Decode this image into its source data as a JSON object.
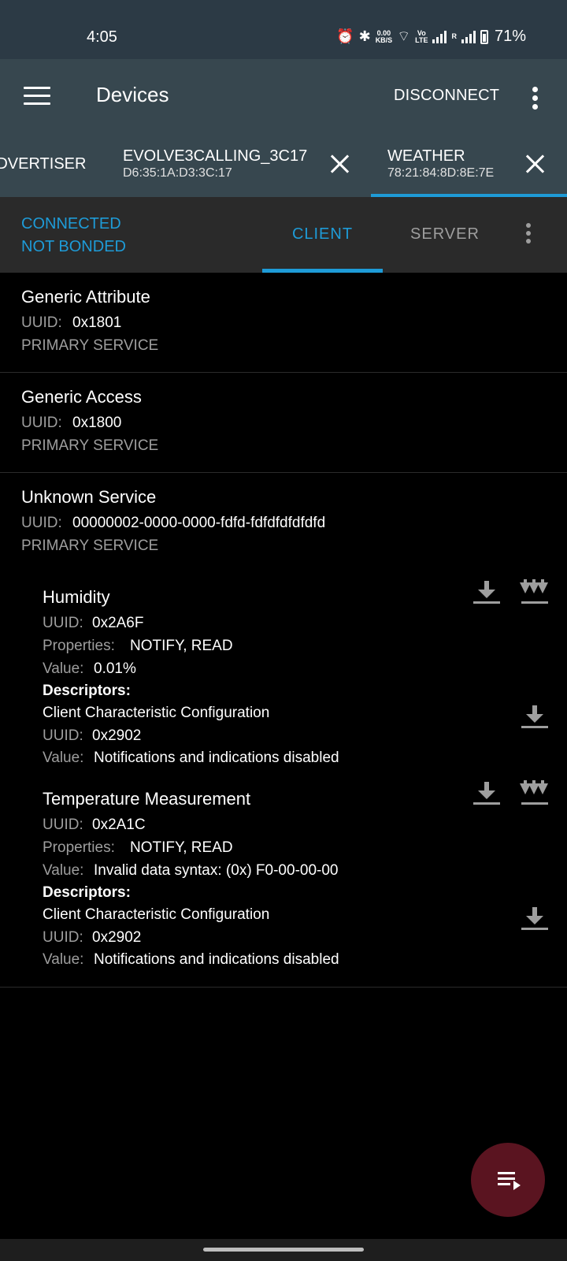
{
  "status_bar": {
    "time": "4:05",
    "net_speed_value": "0.00",
    "net_speed_unit": "KB/S",
    "volte_top": "Vo",
    "volte_bottom": "LTE",
    "roaming": "R",
    "battery": "71%"
  },
  "app_bar": {
    "title": "Devices",
    "disconnect_label": "DISCONNECT"
  },
  "device_tabs": [
    {
      "name": "ADVERTISER",
      "address": ""
    },
    {
      "name": "EVOLVE3CALLING_3C17",
      "address": "D6:35:1A:D3:3C:17"
    },
    {
      "name": "WEATHER",
      "address": "78:21:84:8D:8E:7E",
      "selected": true
    }
  ],
  "connection": {
    "state": "CONNECTED",
    "bond": "NOT BONDED"
  },
  "role_tabs": {
    "client": "CLIENT",
    "server": "SERVER",
    "selected": "CLIENT"
  },
  "labels": {
    "uuid": "UUID:",
    "properties": "Properties:",
    "value": "Value:",
    "descriptors": "Descriptors:"
  },
  "services": [
    {
      "name": "Generic Attribute",
      "uuid": "0x1801",
      "type": "PRIMARY SERVICE"
    },
    {
      "name": "Generic Access",
      "uuid": "0x1800",
      "type": "PRIMARY SERVICE"
    },
    {
      "name": "Unknown Service",
      "uuid": "00000002-0000-0000-fdfd-fdfdfdfdfdfd",
      "type": "PRIMARY SERVICE",
      "characteristics": [
        {
          "name": "Humidity",
          "uuid": "0x2A6F",
          "properties": "NOTIFY, READ",
          "value": "0.01%",
          "descriptor": {
            "name": "Client Characteristic Configuration",
            "uuid": "0x2902",
            "value": "Notifications and indications disabled"
          }
        },
        {
          "name": "Temperature Measurement",
          "uuid": "0x2A1C",
          "properties": "NOTIFY, READ",
          "value": "Invalid data syntax: (0x) F0-00-00-00",
          "descriptor": {
            "name": "Client Characteristic Configuration",
            "uuid": "0x2902",
            "value": "Notifications and indications disabled"
          }
        }
      ]
    }
  ],
  "icons": {
    "read": "download-icon",
    "notify": "notify-icon",
    "menu": "menu-icon",
    "more": "more-vert-icon",
    "close": "close-icon",
    "fab": "log-icon"
  },
  "colors": {
    "accent": "#1e9bd7",
    "app_bar": "#37474f",
    "fab": "#5a1420"
  }
}
